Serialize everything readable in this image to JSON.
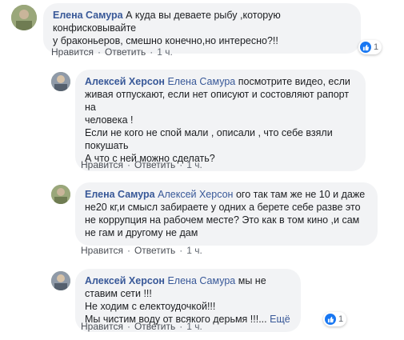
{
  "comments": [
    {
      "author": "Елена Самура",
      "mention": "",
      "text": "А куда вы деваете рыбу ,которую конфисковывайте\nу браконьеров, смешно конечно,но интересно?!!",
      "like_label": "Нравится",
      "reply_label": "Ответить",
      "time": "1 ч.",
      "reaction_count": "1"
    },
    {
      "author": "Алексей Херсон",
      "mention": "Елена Самура",
      "text": "посмотрите видео, если\nживая отпускают, если нет описуют и состовляют рапорт на\nчеловека !\nЕсли не кого не спой мали , описали , что себе взяли\nпокушать\nА что с ней можно сделать?",
      "like_label": "Нравится",
      "reply_label": "Ответить",
      "time": "1 ч."
    },
    {
      "author": "Елена Самура",
      "mention": "Алексей Херсон",
      "text": "ого так там же не 10 и даже\nне20 кг,и смысл забираете у одних а берете себе разве это\nне коррупция на рабочем месте? Это как в том кино ,и сам\nне гам и другому не дам",
      "like_label": "Нравится",
      "reply_label": "Ответить",
      "time": "1 ч."
    },
    {
      "author": "Алексей Херсон",
      "mention": "Елена Самура",
      "text": "мы не ставим сети !!!\nНе ходим с електоудочкой!!!\nМы чистим воду от всякого дерьмя !!!...",
      "more_label": "Ещё",
      "like_label": "Нравится",
      "reply_label": "Ответить",
      "time": "1 ч.",
      "reaction_count": "1"
    }
  ],
  "colors": {
    "author": "#385898",
    "bubble": "#f2f3f5",
    "like": "#1877f2"
  }
}
